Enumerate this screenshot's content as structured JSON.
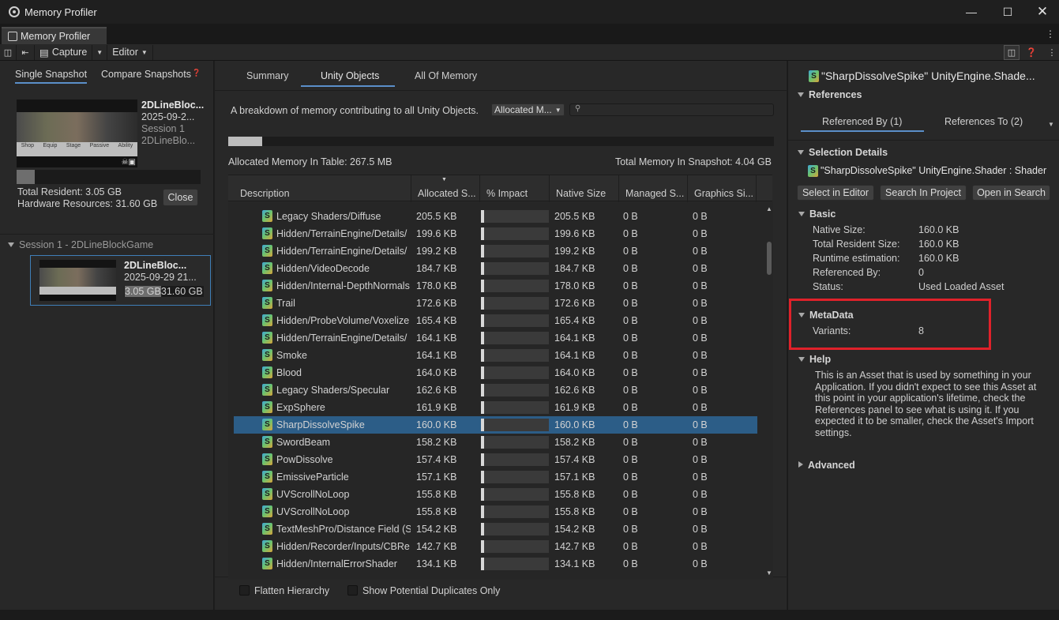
{
  "window": {
    "title": "Memory Profiler"
  },
  "tab": {
    "label": "Memory Profiler"
  },
  "toolbar": {
    "capture_label": "Capture",
    "editor_label": "Editor"
  },
  "left": {
    "tabs": [
      "Single Snapshot",
      "Compare Snapshots"
    ],
    "snapshot": {
      "name": "2DLineBloc...",
      "date": "2025-09-2...",
      "session": "Session 1",
      "project": "2DLineBlo..."
    },
    "resident_fraction": 0.1,
    "total_resident": "Total Resident: 3.05 GB",
    "hardware_resources": "Hardware Resources: 31.60 GB",
    "close_label": "Close",
    "session_header": "Session 1 - 2DLineBlockGame",
    "session_item": {
      "name": "2DLineBloc...",
      "date": "2025-09-29 21...",
      "resident_a": "3.05 GB",
      "resident_b": "31.60 GB"
    },
    "thumb_labels": [
      "Shop",
      "Equip",
      "Stage",
      "Passive",
      "Ability"
    ]
  },
  "center": {
    "tabs": [
      "Summary",
      "Unity Objects",
      "All Of Memory"
    ],
    "description": "A breakdown of memory contributing to all Unity Objects.",
    "dropdown_value": "Allocated M...",
    "allocated_in_table": "Allocated Memory In Table: 267.5 MB",
    "total_in_snapshot": "Total Memory In Snapshot: 4.04 GB",
    "columns": [
      "Description",
      "Allocated S...",
      "% Impact",
      "Native Size",
      "Managed S...",
      "Graphics Si..."
    ],
    "rows": [
      {
        "name": "Legacy Shaders/Diffuse",
        "allocated": "205.5 KB",
        "impact": 0.05,
        "native": "205.5 KB",
        "managed": "0 B",
        "graphics": "0 B"
      },
      {
        "name": "Hidden/TerrainEngine/Details/",
        "allocated": "199.6 KB",
        "impact": 0.05,
        "native": "199.6 KB",
        "managed": "0 B",
        "graphics": "0 B"
      },
      {
        "name": "Hidden/TerrainEngine/Details/",
        "allocated": "199.2 KB",
        "impact": 0.05,
        "native": "199.2 KB",
        "managed": "0 B",
        "graphics": "0 B"
      },
      {
        "name": "Hidden/VideoDecode",
        "allocated": "184.7 KB",
        "impact": 0.05,
        "native": "184.7 KB",
        "managed": "0 B",
        "graphics": "0 B"
      },
      {
        "name": "Hidden/Internal-DepthNormals",
        "allocated": "178.0 KB",
        "impact": 0.05,
        "native": "178.0 KB",
        "managed": "0 B",
        "graphics": "0 B"
      },
      {
        "name": "Trail",
        "allocated": "172.6 KB",
        "impact": 0.05,
        "native": "172.6 KB",
        "managed": "0 B",
        "graphics": "0 B"
      },
      {
        "name": "Hidden/ProbeVolume/Voxelize",
        "allocated": "165.4 KB",
        "impact": 0.05,
        "native": "165.4 KB",
        "managed": "0 B",
        "graphics": "0 B"
      },
      {
        "name": "Hidden/TerrainEngine/Details/",
        "allocated": "164.1 KB",
        "impact": 0.05,
        "native": "164.1 KB",
        "managed": "0 B",
        "graphics": "0 B"
      },
      {
        "name": "Smoke",
        "allocated": "164.1 KB",
        "impact": 0.05,
        "native": "164.1 KB",
        "managed": "0 B",
        "graphics": "0 B"
      },
      {
        "name": "Blood",
        "allocated": "164.0 KB",
        "impact": 0.05,
        "native": "164.0 KB",
        "managed": "0 B",
        "graphics": "0 B"
      },
      {
        "name": "Legacy Shaders/Specular",
        "allocated": "162.6 KB",
        "impact": 0.05,
        "native": "162.6 KB",
        "managed": "0 B",
        "graphics": "0 B"
      },
      {
        "name": "ExpSphere",
        "allocated": "161.9 KB",
        "impact": 0.05,
        "native": "161.9 KB",
        "managed": "0 B",
        "graphics": "0 B"
      },
      {
        "name": "SharpDissolveSpike",
        "allocated": "160.0 KB",
        "impact": 0.05,
        "native": "160.0 KB",
        "managed": "0 B",
        "graphics": "0 B",
        "selected": true
      },
      {
        "name": "SwordBeam",
        "allocated": "158.2 KB",
        "impact": 0.05,
        "native": "158.2 KB",
        "managed": "0 B",
        "graphics": "0 B"
      },
      {
        "name": "PowDissolve",
        "allocated": "157.4 KB",
        "impact": 0.05,
        "native": "157.4 KB",
        "managed": "0 B",
        "graphics": "0 B"
      },
      {
        "name": "EmissiveParticle",
        "allocated": "157.1 KB",
        "impact": 0.05,
        "native": "157.1 KB",
        "managed": "0 B",
        "graphics": "0 B"
      },
      {
        "name": "UVScrollNoLoop",
        "allocated": "155.8 KB",
        "impact": 0.05,
        "native": "155.8 KB",
        "managed": "0 B",
        "graphics": "0 B"
      },
      {
        "name": "UVScrollNoLoop",
        "allocated": "155.8 KB",
        "impact": 0.05,
        "native": "155.8 KB",
        "managed": "0 B",
        "graphics": "0 B"
      },
      {
        "name": "TextMeshPro/Distance Field (S",
        "allocated": "154.2 KB",
        "impact": 0.05,
        "native": "154.2 KB",
        "managed": "0 B",
        "graphics": "0 B"
      },
      {
        "name": "Hidden/Recorder/Inputs/CBRe",
        "allocated": "142.7 KB",
        "impact": 0.05,
        "native": "142.7 KB",
        "managed": "0 B",
        "graphics": "0 B"
      },
      {
        "name": "Hidden/InternalErrorShader",
        "allocated": "134.1 KB",
        "impact": 0.05,
        "native": "134.1 KB",
        "managed": "0 B",
        "graphics": "0 B"
      }
    ],
    "flatten_label": "Flatten Hierarchy",
    "duplicates_label": "Show Potential Duplicates Only"
  },
  "right": {
    "title": "\"SharpDissolveSpike\" UnityEngine.Shade...",
    "references_header": "References",
    "ref_tabs": [
      "Referenced By (1)",
      "References To (2)"
    ],
    "selection_header": "Selection Details",
    "selection_name": "\"SharpDissolveSpike\" UnityEngine.Shader : Shader",
    "buttons": [
      "Select in Editor",
      "Search In Project",
      "Open in Search"
    ],
    "basic_header": "Basic",
    "basic": [
      {
        "k": "Native Size:",
        "v": "160.0 KB"
      },
      {
        "k": "Total Resident Size:",
        "v": "160.0 KB"
      },
      {
        "k": "Runtime estimation:",
        "v": "160.0 KB"
      },
      {
        "k": "Referenced By:",
        "v": "0"
      },
      {
        "k": "Status:",
        "v": "Used Loaded Asset"
      }
    ],
    "metadata_header": "MetaData",
    "metadata": [
      {
        "k": "Variants:",
        "v": "8"
      }
    ],
    "help_header": "Help",
    "help_text": "This is an Asset that is used by something in your Application. If you didn't expect to see this Asset at this point in your application's lifetime, check the References panel to see what is using it. If you expected it to be smaller, check the Asset's Import settings.",
    "advanced_header": "Advanced"
  },
  "colors": {
    "selection": "#2c5d87",
    "accent": "#5b8fc9",
    "highlight_box": "#e0212a"
  }
}
